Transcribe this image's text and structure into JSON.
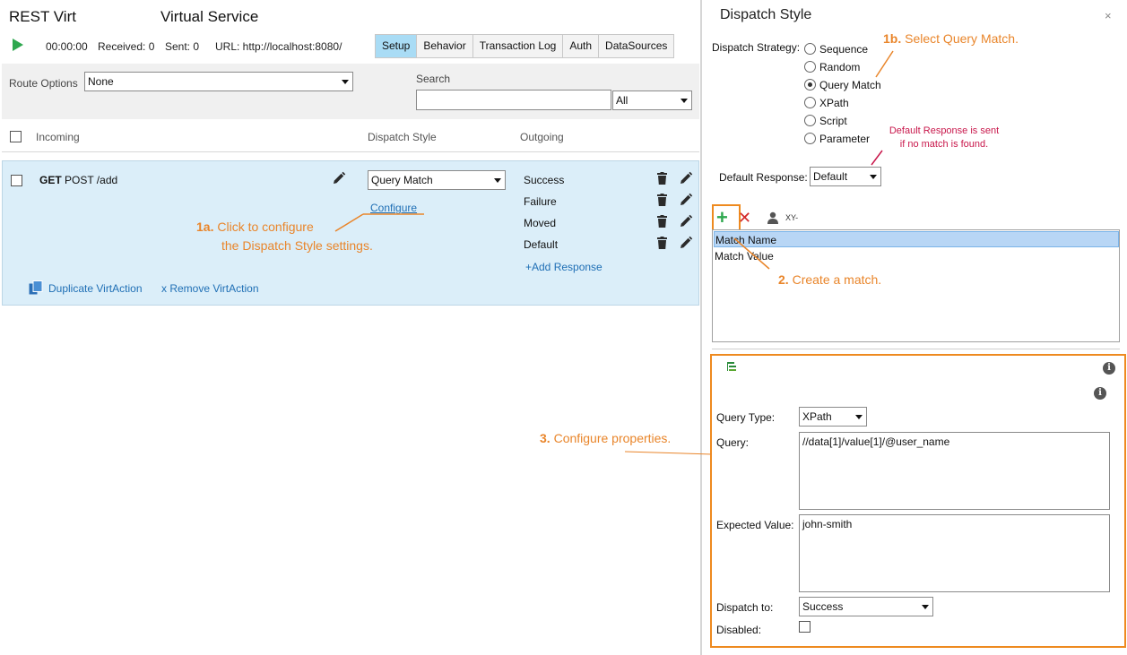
{
  "header": {
    "app_title": "REST Virt",
    "service_title": "Virtual Service",
    "timer": "00:00:00",
    "received": "Received: 0",
    "sent": "Sent: 0",
    "url": "URL: http://localhost:8080/"
  },
  "tabs": [
    {
      "label": "Setup",
      "active": true
    },
    {
      "label": "Behavior"
    },
    {
      "label": "Transaction Log"
    },
    {
      "label": "Auth"
    },
    {
      "label": "DataSources"
    }
  ],
  "route": {
    "label": "Route Options",
    "value": "None",
    "search_label": "Search",
    "search_value": "",
    "filter_value": "All"
  },
  "columns": {
    "incoming": "Incoming",
    "dispatch_style": "Dispatch Style",
    "outgoing": "Outgoing"
  },
  "action": {
    "method": "GET",
    "path": "POST /add",
    "dispatch_value": "Query Match",
    "configure": "Configure",
    "responses": [
      "Success",
      "Failure",
      "Moved",
      "Default"
    ],
    "add_response": "+Add Response",
    "duplicate": "Duplicate VirtAction",
    "remove": "x Remove VirtAction"
  },
  "callouts": {
    "c1a_num": "1a.",
    "c1a_line1": "Click to configure",
    "c1a_line2": "the Dispatch Style settings.",
    "c1b_num": "1b.",
    "c1b_text": "Select Query Match.",
    "c2_num": "2.",
    "c2_text": "Create a match.",
    "c3_num": "3.",
    "c3_text": "Configure properties.",
    "note_line1": "Default Response is sent",
    "note_line2": "if no match is found."
  },
  "dispatch_panel": {
    "title": "Dispatch Style",
    "close": "×",
    "strategy_label": "Dispatch Strategy:",
    "strategies": [
      "Sequence",
      "Random",
      "Query Match",
      "XPath",
      "Script",
      "Parameter"
    ],
    "selected_strategy": "Query Match",
    "default_response_label": "Default Response:",
    "default_response_value": "Default",
    "toolbar_xy": "XY-",
    "matches": [
      "Match Name",
      "Match Value"
    ]
  },
  "properties": {
    "query_type_label": "Query Type:",
    "query_type_value": "XPath",
    "query_label": "Query:",
    "query_value": "//data[1]/value[1]/@user_name",
    "expected_label": "Expected Value:",
    "expected_value": "john-smith",
    "dispatch_to_label": "Dispatch to:",
    "dispatch_to_value": "Success",
    "disabled_label": "Disabled:"
  },
  "colors": {
    "accent_orange": "#e9852a",
    "note_red": "#c8174b",
    "link_blue": "#1f6fb5",
    "tab_active": "#a9dcf5",
    "row_bg": "#dbeef9",
    "play_green": "#2fa84f"
  }
}
